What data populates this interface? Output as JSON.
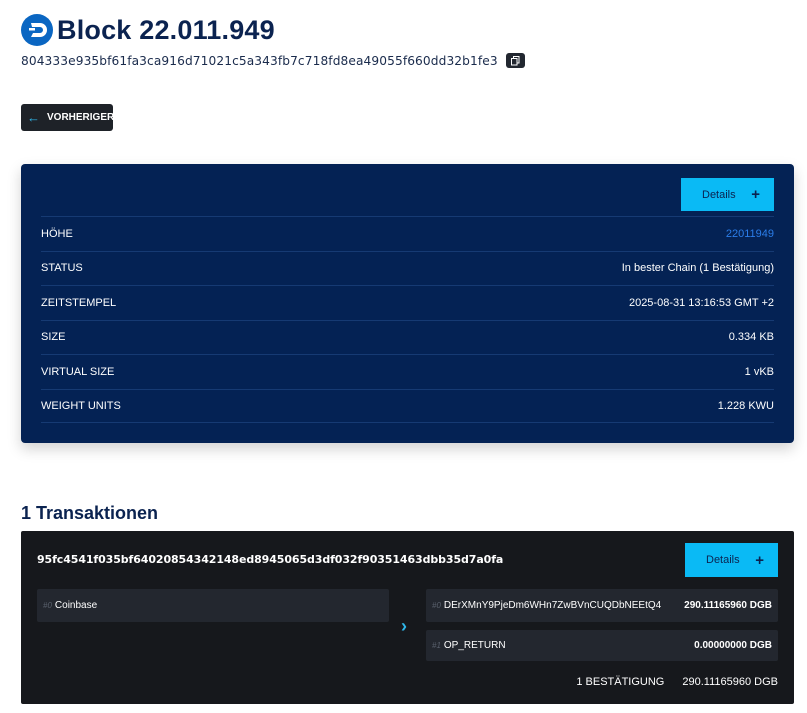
{
  "header": {
    "title": "Block 22.011.949",
    "block_hash": "804333e935bf61fa3ca916d71021c5a343fb7c718fd8ea49055f660dd32b1fe3"
  },
  "nav": {
    "previous_label": "VORHERIGER"
  },
  "block_info": {
    "details_label": "Details",
    "rows": [
      {
        "label": "HÖHE",
        "value": "22011949"
      },
      {
        "label": "STATUS",
        "value": "In bester Chain (1 Bestätigung)"
      },
      {
        "label": "ZEITSTEMPEL",
        "value": "2025-08-31 13:16:53 GMT +2"
      },
      {
        "label": "SIZE",
        "value": "0.334 KB"
      },
      {
        "label": "VIRTUAL SIZE",
        "value": "1 vKB"
      },
      {
        "label": "WEIGHT UNITS",
        "value": "1.228 KWU"
      }
    ]
  },
  "transactions": {
    "heading": "1 Transaktionen",
    "items": [
      {
        "txid": "95fc4541f035bf64020854342148ed8945065d3df032f90351463dbb35d7a0fa",
        "details_label": "Details",
        "inputs": [
          {
            "index": "#0",
            "label": "Coinbase"
          }
        ],
        "outputs": [
          {
            "index": "#0",
            "address": "DErXMnY9PjeDm6WHn7ZwBVnCUQDbNEEtQ4",
            "amount": "290.11165960 DGB"
          },
          {
            "index": "#1",
            "address": "OP_RETURN",
            "amount": "0.00000000 DGB"
          }
        ],
        "confirmations": "1 BESTÄTIGUNG",
        "total": "290.11165960 DGB"
      }
    ]
  },
  "colors": {
    "accent": "#0abaf5",
    "card_bg": "#042254",
    "tx_bg": "#16181c",
    "link": "#2b7de9"
  }
}
